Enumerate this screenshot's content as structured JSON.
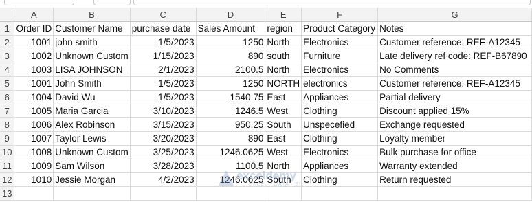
{
  "columns": [
    "A",
    "B",
    "C",
    "D",
    "E",
    "F",
    "G"
  ],
  "rows": [
    {
      "num": "1",
      "cells": [
        "Order ID",
        "Customer Name",
        "purchase date",
        "Sales Amount",
        "region",
        "Product Category",
        "Notes"
      ]
    },
    {
      "num": "2",
      "cells": [
        "1001",
        "john smith",
        "1/5/2023",
        "1250",
        "North",
        "Electronics",
        "Customer reference: REF-A12345"
      ]
    },
    {
      "num": "3",
      "cells": [
        "1002",
        "Unknown Custom",
        "1/15/2023",
        "890",
        "south",
        "Furniture",
        "Late delivery ref code: REF-B67890"
      ]
    },
    {
      "num": "4",
      "cells": [
        "1003",
        "LISA JOHNSON",
        "2/1/2023",
        "2100.5",
        "North",
        "Electronics",
        "No Comments"
      ]
    },
    {
      "num": "5",
      "cells": [
        "1001",
        "John Smith",
        "1/5/2023",
        "1250",
        "NORTH",
        "electronics",
        "Customer reference: REF-A12345"
      ]
    },
    {
      "num": "6",
      "cells": [
        "1004",
        "David Wu",
        "1/5/2023",
        "1540.75",
        "East",
        "Appliances",
        "Partial delivery"
      ]
    },
    {
      "num": "7",
      "cells": [
        "1005",
        "Maria Garcia",
        "3/10/2023",
        "1246.5",
        "West",
        "Clothing",
        "Discount applied 15%"
      ]
    },
    {
      "num": "8",
      "cells": [
        "1006",
        "Alex Robinson",
        "3/15/2023",
        "950.25",
        "South",
        "Unspecefied",
        "Exchange requested"
      ]
    },
    {
      "num": "9",
      "cells": [
        "1007",
        "Taylor Lewis",
        "3/20/2023",
        "890",
        "East",
        "Clothing",
        "Loyalty member"
      ]
    },
    {
      "num": "10",
      "cells": [
        "1008",
        "Unknown Custom",
        "3/25/2023",
        "1246.0625",
        "West",
        "Electronics",
        "Bulk purchase for office"
      ]
    },
    {
      "num": "11",
      "cells": [
        "1009",
        "Sam Wilson",
        "3/28/2023",
        "1100.5",
        "North",
        "Appliances",
        "Warranty extended"
      ]
    },
    {
      "num": "12",
      "cells": [
        "1010",
        "Jessie Morgan",
        "4/2/2023",
        "1246.0625",
        "South",
        "Clothing",
        "Return requested"
      ]
    },
    {
      "num": "13",
      "cells": [
        "",
        "",
        "",
        "",
        "",
        "",
        ""
      ]
    }
  ],
  "watermark": {
    "name": "exceldemy",
    "tagline": "EXCEL · DATA · BI"
  }
}
